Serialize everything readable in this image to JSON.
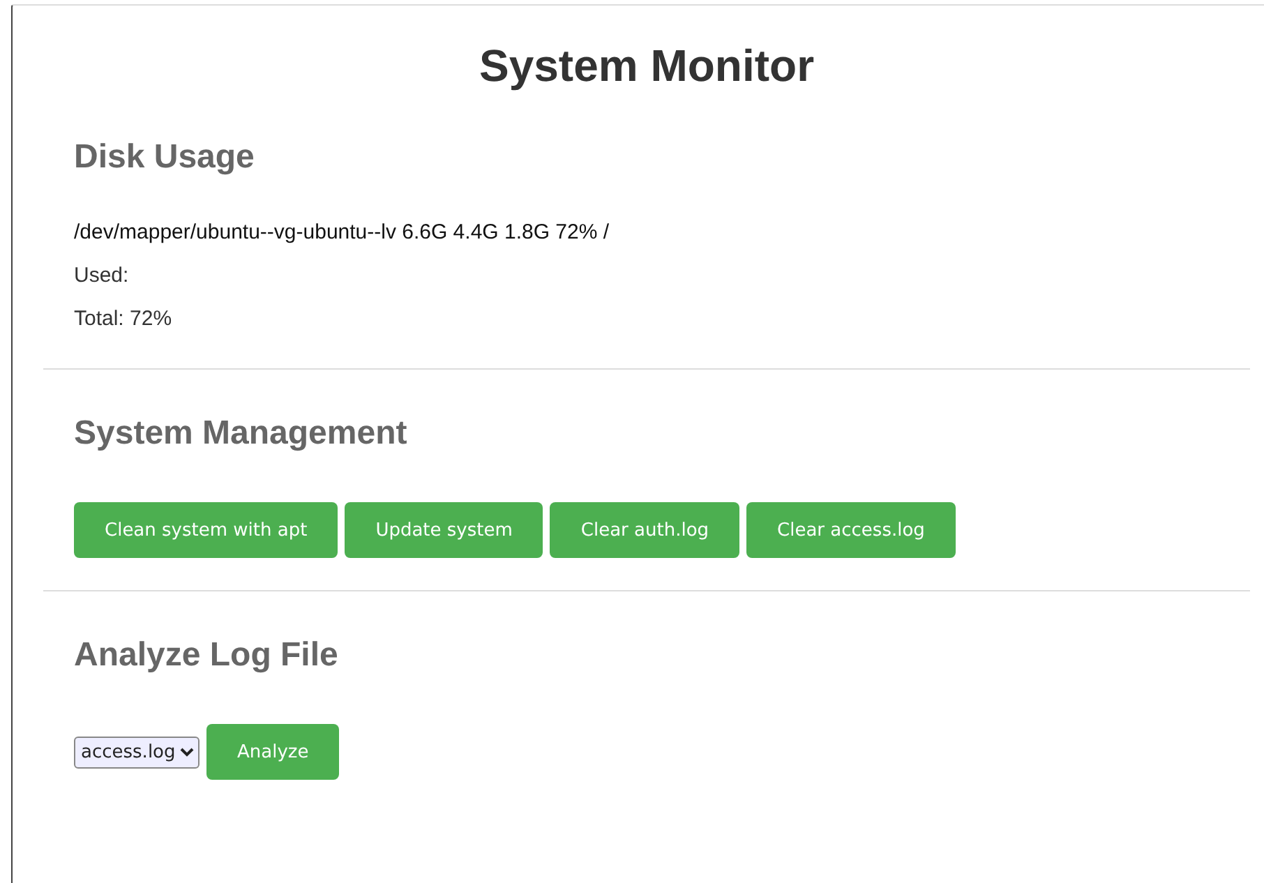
{
  "title": "System Monitor",
  "disk_usage": {
    "heading": "Disk Usage",
    "lines": [
      "/dev/mapper/ubuntu--vg-ubuntu--lv 6.6G 4.4G 1.8G 72% /",
      "Used:",
      "Total: 72%"
    ]
  },
  "system_management": {
    "heading": "System Management",
    "buttons": [
      "Clean system with apt",
      "Update system",
      "Clear auth.log",
      "Clear access.log"
    ]
  },
  "analyze_log": {
    "heading": "Analyze Log File",
    "select": {
      "value": "access.log"
    },
    "button": "Analyze"
  }
}
